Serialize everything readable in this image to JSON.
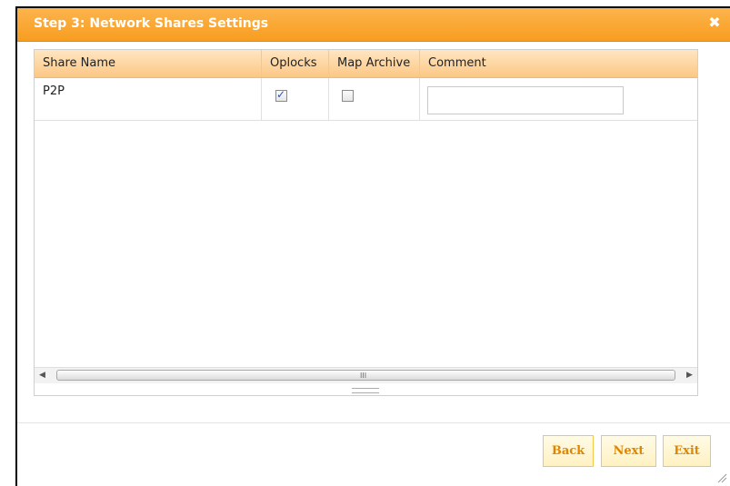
{
  "dialog": {
    "title": "Step 3: Network Shares Settings",
    "close_symbol": "✖"
  },
  "grid": {
    "columns": [
      "Share Name",
      "Oplocks",
      "Map Archive",
      "Comment"
    ],
    "rows": [
      {
        "share_name": "P2P",
        "oplocks": true,
        "map_archive": false,
        "comment": ""
      }
    ],
    "scroll_grip": "III"
  },
  "buttons": {
    "back": "Back",
    "next": "Next",
    "exit": "Exit"
  },
  "colors": {
    "titlebar": "#f79d20",
    "header": "#fbc784",
    "button_text": "#e08500",
    "button_border": "#f2c94c"
  }
}
